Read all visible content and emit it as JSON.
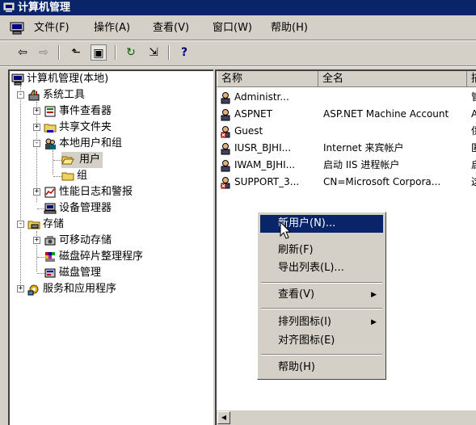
{
  "window": {
    "title": "计算机管理"
  },
  "menu": [
    "文件(F)",
    "操作(A)",
    "查看(V)",
    "窗口(W)",
    "帮助(H)"
  ],
  "toolbar": {
    "buttons": [
      {
        "name": "back-icon",
        "glyph": "⇦"
      },
      {
        "name": "forward-icon",
        "glyph": "⇨"
      },
      {
        "name": "up-folder-icon",
        "glyph": "⬑"
      },
      {
        "name": "show-tree-icon",
        "glyph": "▣"
      },
      {
        "name": "refresh-icon",
        "glyph": "↻"
      },
      {
        "name": "export-list-icon",
        "glyph": "⇲"
      },
      {
        "name": "help-icon",
        "glyph": "?"
      }
    ]
  },
  "tree": {
    "root": "计算机管理(本地)",
    "system_tools": "系统工具",
    "event_viewer": "事件查看器",
    "shared_folders": "共享文件夹",
    "local_users_groups": "本地用户和组",
    "users": "用户",
    "groups": "组",
    "perf_logs": "性能日志和警报",
    "device_manager": "设备管理器",
    "storage": "存储",
    "removable_storage": "可移动存储",
    "defrag": "磁盘碎片整理程序",
    "disk_management": "磁盘管理",
    "services_apps": "服务和应用程序"
  },
  "list": {
    "columns": [
      "名称",
      "全名",
      "描"
    ],
    "rows": [
      {
        "name": "Administr...",
        "fullname": "",
        "disabled": false
      },
      {
        "name": "ASPNET",
        "fullname": "ASP.NET Machine Account",
        "disabled": false
      },
      {
        "name": "Guest",
        "fullname": "",
        "disabled": true
      },
      {
        "name": "IUSR_BJHI...",
        "fullname": "Internet 来宾帐户",
        "disabled": false
      },
      {
        "name": "IWAM_BJHI...",
        "fullname": "启动 IIS 进程帐户",
        "disabled": false
      },
      {
        "name": "SUPPORT_3...",
        "fullname": "CN=Microsoft Corpora...",
        "disabled": true
      }
    ],
    "desc_fragments": [
      "管",
      "A",
      "供",
      "匿",
      "启",
      "这"
    ]
  },
  "context_menu": {
    "new_user": "新用户(N)...",
    "refresh": "刷新(F)",
    "export_list": "导出列表(L)...",
    "view": "查看(V)",
    "arrange_icons": "排列图标(I)",
    "line_up_icons": "对齐图标(E)",
    "help": "帮助(H)"
  },
  "colors": {
    "title_bg": "#0a246a",
    "highlight": "#0a246a",
    "face": "#d4d0c8"
  }
}
